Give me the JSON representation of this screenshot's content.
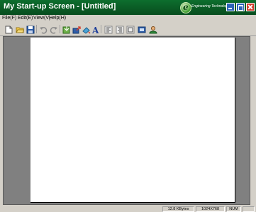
{
  "window": {
    "title": "My Start-up Screen - [Untitled]",
    "brand_tagline": "Engineering Technology"
  },
  "menu": [
    {
      "label": "File(F)"
    },
    {
      "label": "Edit(E)"
    },
    {
      "label": "View(V)"
    },
    {
      "label": "Help(H)"
    }
  ],
  "toolbar": {
    "icons": [
      "new-file-icon",
      "open-folder-icon",
      "save-icon",
      "undo-icon",
      "redo-icon",
      "import-icon",
      "export-icon",
      "paint-icon",
      "text-icon",
      "align-left-icon",
      "align-right-icon",
      "center-icon",
      "resolution-icon",
      "user-icon"
    ]
  },
  "status": {
    "size": "12.8 KBytes",
    "resolution": "1024X768",
    "numlock": "NUM"
  },
  "colors": {
    "title_green": "#0a5a24",
    "workspace_gray": "#808080",
    "canvas": "#ffffff"
  }
}
